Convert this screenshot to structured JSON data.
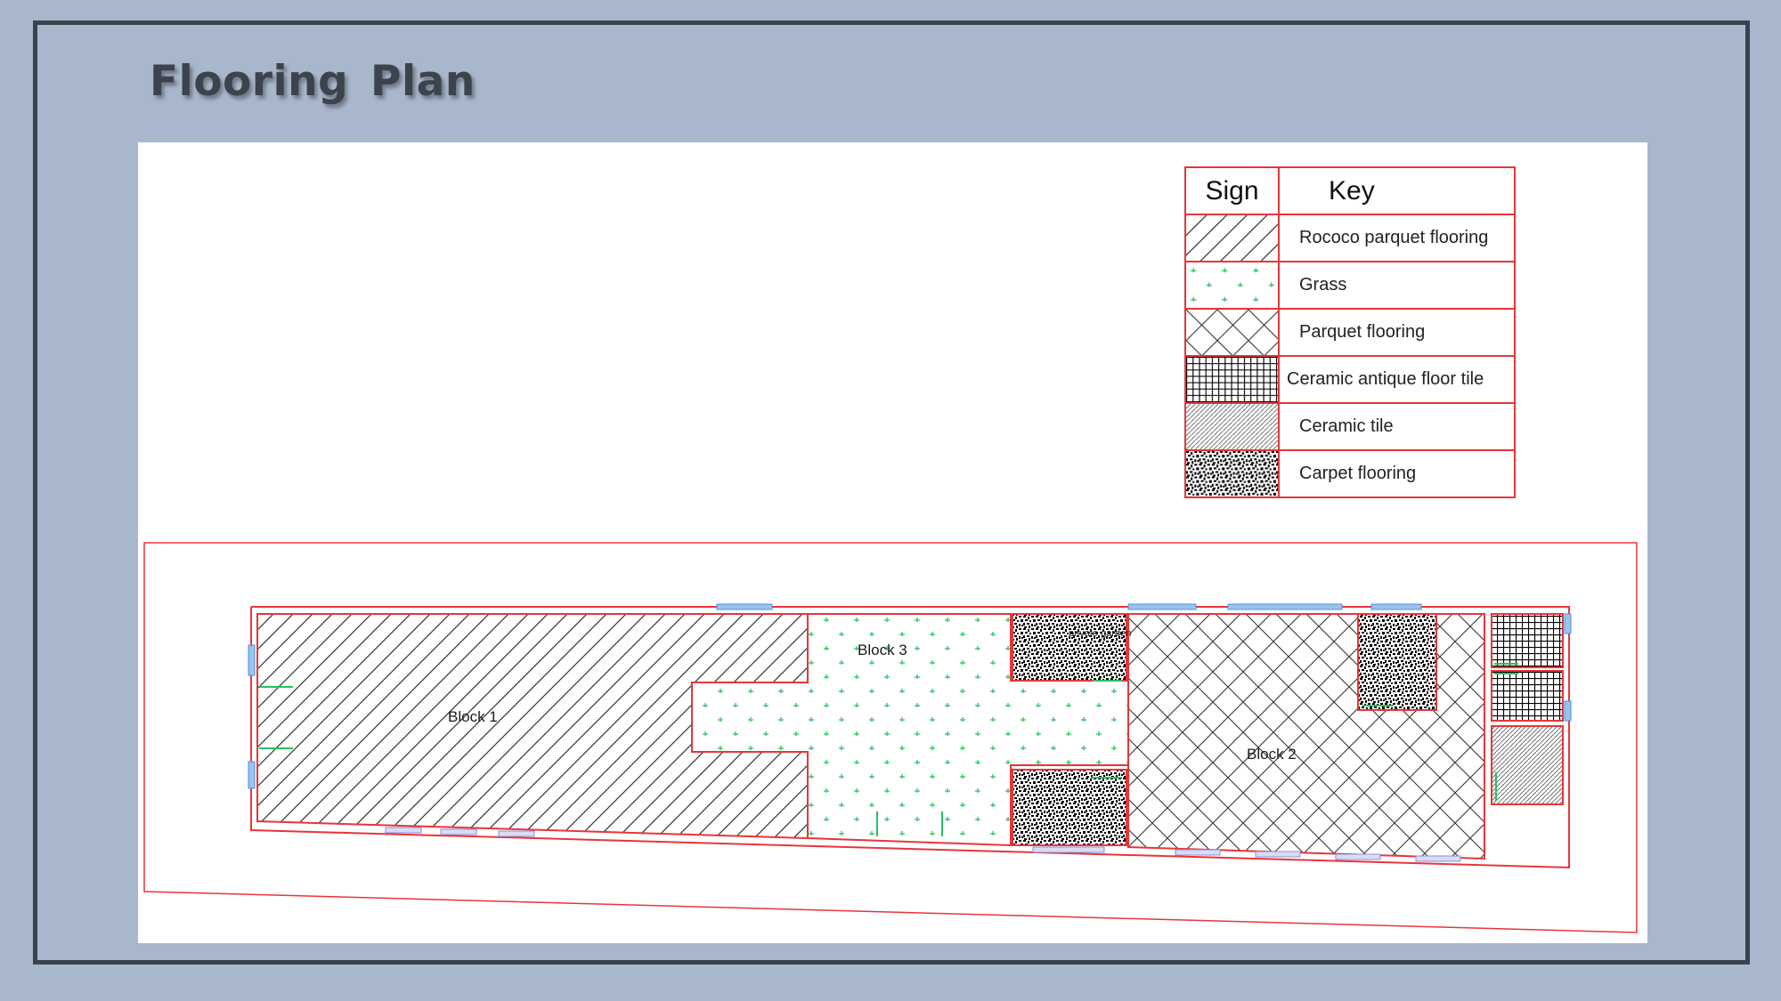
{
  "title": "Flooring  Plan",
  "legend": {
    "header_sign": "Sign",
    "header_key": "Key",
    "rows": [
      {
        "key": "Rococo parquet flooring",
        "pattern": "diagonal-hatch"
      },
      {
        "key": "Grass",
        "pattern": "green-dots"
      },
      {
        "key": "Parquet flooring",
        "pattern": "cross-hatch"
      },
      {
        "key": "Ceramic antique floor tile",
        "pattern": "grid"
      },
      {
        "key": "Ceramic tile",
        "pattern": "fine-hatch"
      },
      {
        "key": "Carpet flooring",
        "pattern": "speckle"
      }
    ]
  },
  "plan": {
    "block1": "Block 1",
    "block2": "Block 2",
    "block3": "Block 3",
    "small_label_1": "private garden",
    "colors": {
      "wall": "#e8353a",
      "window": "#4a90e2",
      "door": "#22c55e",
      "grass": "#22c55e",
      "hatch": "#333333"
    }
  }
}
